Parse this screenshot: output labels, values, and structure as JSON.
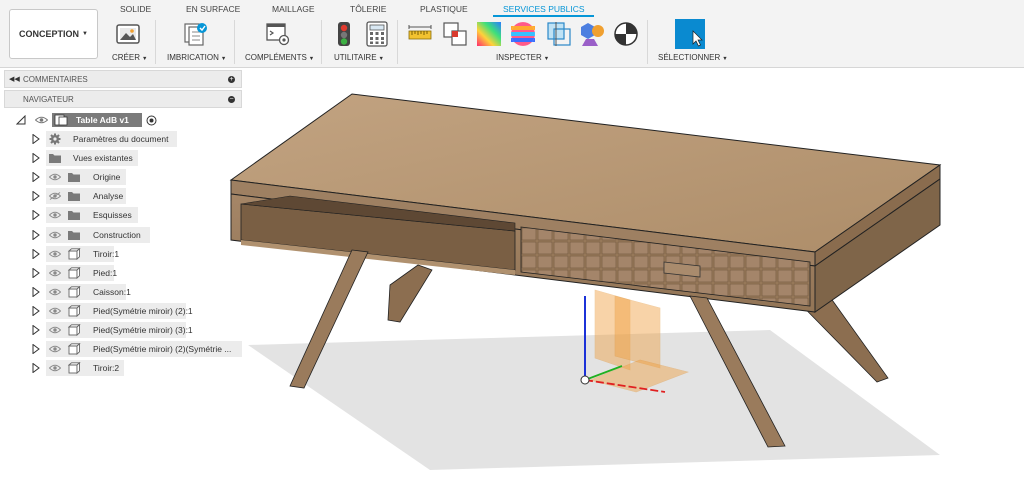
{
  "app": {
    "workspace_label": "CONCEPTION"
  },
  "tabs": [
    {
      "label": "SOLIDE",
      "active": false
    },
    {
      "label": "EN SURFACE",
      "active": false
    },
    {
      "label": "MAILLAGE",
      "active": false
    },
    {
      "label": "TÔLERIE",
      "active": false
    },
    {
      "label": "PLASTIQUE",
      "active": false
    },
    {
      "label": "SERVICES PUBLICS",
      "active": true
    }
  ],
  "groups": {
    "creer": "CRÉER",
    "imbrication": "IMBRICATION",
    "complements": "COMPLÉMENTS",
    "utilitaire": "UTILITAIRE",
    "inspecter": "INSPECTER",
    "selectionner": "SÉLECTIONNER"
  },
  "panel": {
    "comments_label": "COMMENTAIRES",
    "navigator_label": "NAVIGATEUR"
  },
  "tree": {
    "root": "Table AdB v1",
    "items": [
      {
        "label": "Paramètres du document",
        "icon": "gear-icon",
        "eye": false
      },
      {
        "label": "Vues existantes",
        "icon": "folder-icon",
        "eye": false
      },
      {
        "label": "Origine",
        "icon": "folder-icon",
        "eye": true
      },
      {
        "label": "Analyse",
        "icon": "folder-icon",
        "eye": true,
        "eye_hidden": true
      },
      {
        "label": "Esquisses",
        "icon": "folder-icon",
        "eye": true
      },
      {
        "label": "Construction",
        "icon": "folder-icon",
        "eye": true
      },
      {
        "label": "Tiroir:1",
        "icon": "component-icon",
        "eye": true
      },
      {
        "label": "Pied:1",
        "icon": "component-icon",
        "eye": true
      },
      {
        "label": "Caisson:1",
        "icon": "component-icon",
        "eye": true
      },
      {
        "label": "Pied(Symétrie miroir) (2):1",
        "icon": "component-icon",
        "eye": true
      },
      {
        "label": "Pied(Symétrie miroir) (3):1",
        "icon": "component-icon",
        "eye": true
      },
      {
        "label": "Pied(Symétrie miroir) (2)(Symétrie ...",
        "icon": "component-icon",
        "eye": true
      },
      {
        "label": "Tiroir:2",
        "icon": "component-icon",
        "eye": true
      }
    ]
  },
  "colors": {
    "accent": "#0696d7",
    "wood_top": "#b89a78",
    "wood_front": "#9d8060",
    "wood_side": "#7f6549",
    "shadow": "#e4e4e4"
  }
}
